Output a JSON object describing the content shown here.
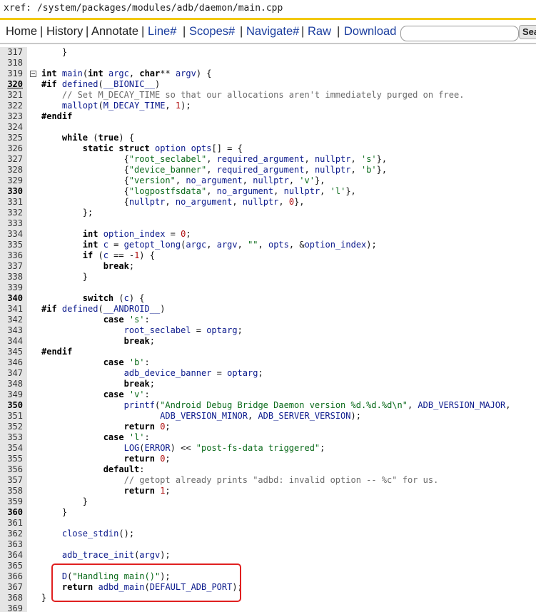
{
  "xref_path": "xref: /system/packages/modules/adb/daemon/main.cpp",
  "nav": {
    "home": "Home",
    "history": "History",
    "annotate": "Annotate",
    "line": "Line#",
    "scopes": "Scopes#",
    "navigate": "Navigate#",
    "raw": "Raw",
    "download": "Download",
    "search_value": "",
    "search_btn": "Sea"
  },
  "colors": {
    "accent_bar": "#f2c811",
    "link": "#1a3d9e",
    "highlight_box": "#e02020"
  },
  "lines": [
    {
      "n": "317",
      "t": "    }"
    },
    {
      "n": "318",
      "t": ""
    },
    {
      "n": "319",
      "t": "int main(int argc, char** argv) {"
    },
    {
      "n": "320",
      "t": "#if defined(__BIONIC__)"
    },
    {
      "n": "321",
      "t": "    // Set M_DECAY_TIME so that our allocations aren't immediately purged on free."
    },
    {
      "n": "322",
      "t": "    mallopt(M_DECAY_TIME, 1);"
    },
    {
      "n": "323",
      "t": "#endif"
    },
    {
      "n": "324",
      "t": ""
    },
    {
      "n": "325",
      "t": "    while (true) {"
    },
    {
      "n": "326",
      "t": "        static struct option opts[] = {"
    },
    {
      "n": "327",
      "t": "                {\"root_seclabel\", required_argument, nullptr, 's'},"
    },
    {
      "n": "328",
      "t": "                {\"device_banner\", required_argument, nullptr, 'b'},"
    },
    {
      "n": "329",
      "t": "                {\"version\", no_argument, nullptr, 'v'},"
    },
    {
      "n": "330",
      "t": "                {\"logpostfsdata\", no_argument, nullptr, 'l'},"
    },
    {
      "n": "331",
      "t": "                {nullptr, no_argument, nullptr, 0},"
    },
    {
      "n": "332",
      "t": "        };"
    },
    {
      "n": "333",
      "t": ""
    },
    {
      "n": "334",
      "t": "        int option_index = 0;"
    },
    {
      "n": "335",
      "t": "        int c = getopt_long(argc, argv, \"\", opts, &option_index);"
    },
    {
      "n": "336",
      "t": "        if (c == -1) {"
    },
    {
      "n": "337",
      "t": "            break;"
    },
    {
      "n": "338",
      "t": "        }"
    },
    {
      "n": "339",
      "t": ""
    },
    {
      "n": "340",
      "t": "        switch (c) {"
    },
    {
      "n": "341",
      "t": "#if defined(__ANDROID__)"
    },
    {
      "n": "342",
      "t": "            case 's':"
    },
    {
      "n": "343",
      "t": "                root_seclabel = optarg;"
    },
    {
      "n": "344",
      "t": "                break;"
    },
    {
      "n": "345",
      "t": "#endif"
    },
    {
      "n": "346",
      "t": "            case 'b':"
    },
    {
      "n": "347",
      "t": "                adb_device_banner = optarg;"
    },
    {
      "n": "348",
      "t": "                break;"
    },
    {
      "n": "349",
      "t": "            case 'v':"
    },
    {
      "n": "350",
      "t": "                printf(\"Android Debug Bridge Daemon version %d.%d.%d\\n\", ADB_VERSION_MAJOR,"
    },
    {
      "n": "351",
      "t": "                       ADB_VERSION_MINOR, ADB_SERVER_VERSION);"
    },
    {
      "n": "352",
      "t": "                return 0;"
    },
    {
      "n": "353",
      "t": "            case 'l':"
    },
    {
      "n": "354",
      "t": "                LOG(ERROR) << \"post-fs-data triggered\";"
    },
    {
      "n": "355",
      "t": "                return 0;"
    },
    {
      "n": "356",
      "t": "            default:"
    },
    {
      "n": "357",
      "t": "                // getopt already prints \"adbd: invalid option -- %c\" for us."
    },
    {
      "n": "358",
      "t": "                return 1;"
    },
    {
      "n": "359",
      "t": "        }"
    },
    {
      "n": "360",
      "t": "    }"
    },
    {
      "n": "361",
      "t": ""
    },
    {
      "n": "362",
      "t": "    close_stdin();"
    },
    {
      "n": "363",
      "t": ""
    },
    {
      "n": "364",
      "t": "    adb_trace_init(argv);"
    },
    {
      "n": "365",
      "t": ""
    },
    {
      "n": "366",
      "t": "    D(\"Handling main()\");"
    },
    {
      "n": "367",
      "t": "    return adbd_main(DEFAULT_ADB_PORT);"
    },
    {
      "n": "368",
      "t": "}"
    },
    {
      "n": "369",
      "t": ""
    }
  ]
}
